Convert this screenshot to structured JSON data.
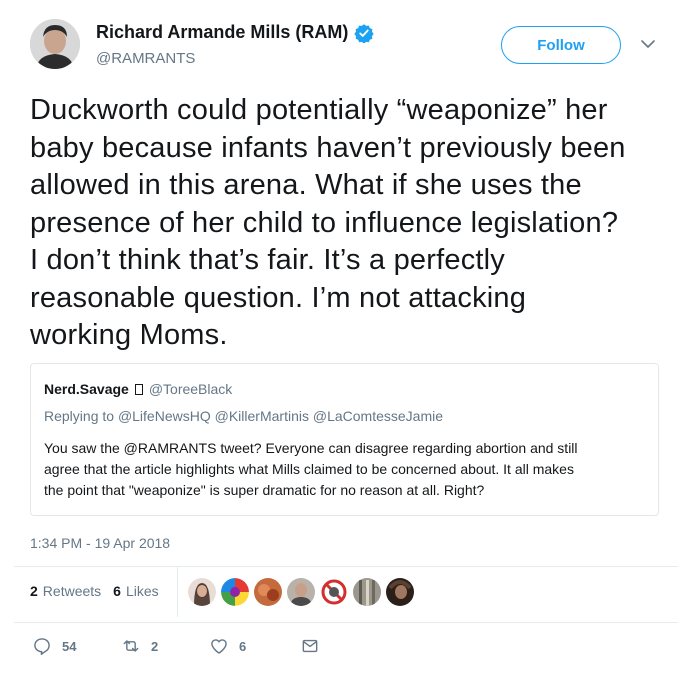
{
  "author": {
    "display_name": "Richard Armande Mills (RAM)",
    "handle": "@RAMRANTS",
    "verified": true
  },
  "follow_label": "Follow",
  "tweet_lines": [
    "Duckworth could potentially “weaponize” her",
    "baby because infants haven’t previously been",
    "allowed in this arena. What if she uses the",
    "presence of her child to influence legislation?",
    "I don’t think that’s fair. It’s a perfectly",
    "reasonable question. I’m not attacking",
    "working Moms."
  ],
  "quoted": {
    "name": "Nerd.Savage",
    "handle": "@ToreeBlack",
    "replying_prefix": "Replying to",
    "replying_to": [
      "@LifeNewsHQ",
      "@KillerMartinis",
      "@LaComtesseJamie"
    ],
    "text_lines": [
      "You saw the @RAMRANTS tweet? Everyone can disagree regarding abortion and still",
      "agree that the article highlights what Mills claimed to be concerned about. It all makes",
      "the point that \"weaponize\" is super dramatic for no reason at all. Right?"
    ]
  },
  "timestamp": "1:34 PM - 19 Apr 2018",
  "stats": {
    "retweets_count": "2",
    "retweets_label": "Retweets",
    "likes_count": "6",
    "likes_label": "Likes"
  },
  "likers": [
    "#6b4a3a",
    "rainbow",
    "#b5552e",
    "#8a8078",
    "blocked",
    "#8c8a80",
    "#3a2a20"
  ],
  "actions": {
    "reply_count": "54",
    "retweet_count": "2",
    "like_count": "6"
  },
  "colors": {
    "accent": "#1da1f2",
    "muted": "#657786",
    "text": "#14171a",
    "border": "#e6ecf0"
  }
}
